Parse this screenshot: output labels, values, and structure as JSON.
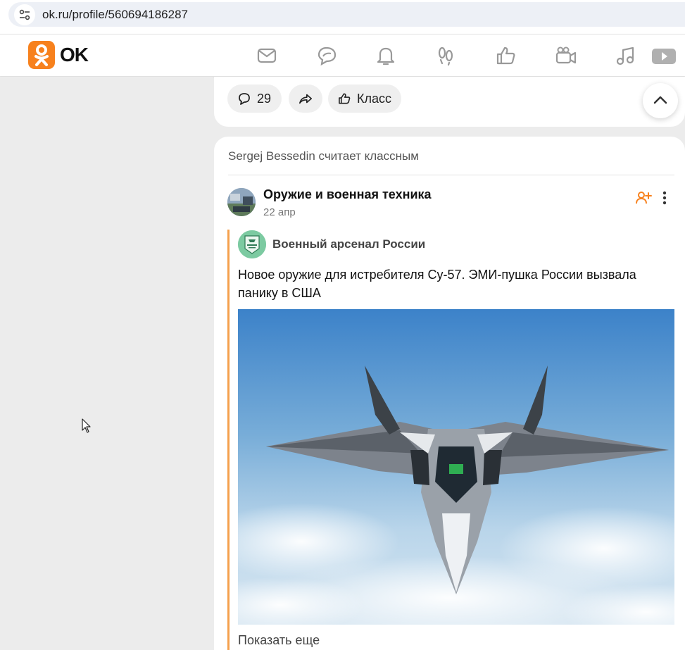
{
  "browser": {
    "url": "ok.ru/profile/560694186287",
    "site_info_icon": "tune-icon"
  },
  "header": {
    "logo_text": "OK",
    "brand_color": "#f7811d",
    "nav_icons": [
      "envelope-icon",
      "chat-bubbles-icon",
      "bell-icon",
      "footprints-icon",
      "thumbs-up-icon",
      "video-camera-icon",
      "music-note-icon",
      "play-video-icon"
    ]
  },
  "prev_post": {
    "comments_count": "29",
    "like_label": "Класс"
  },
  "post": {
    "liked_by": "Sergej Bessedin считает классным",
    "group_name": "Оружие и военная техника",
    "date": "22 апр",
    "source_name": "Военный арсенал России",
    "text": "Новое оружие для истребителя Су-57. ЭМИ-пушка России вызвала панику в США",
    "show_more": "Показать еще",
    "accent_color": "#f5a04c"
  }
}
